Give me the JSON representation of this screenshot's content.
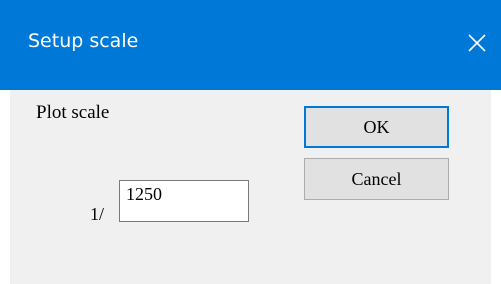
{
  "window": {
    "title": "Setup scale",
    "close_icon": "close-icon"
  },
  "form": {
    "plot_scale_label": "Plot scale",
    "ratio_prefix": "1/",
    "scale_value": "1250"
  },
  "buttons": {
    "ok_label": "OK",
    "cancel_label": "Cancel"
  },
  "colors": {
    "titlebar": "#0078d7",
    "default_button_border": "#0078d7"
  }
}
